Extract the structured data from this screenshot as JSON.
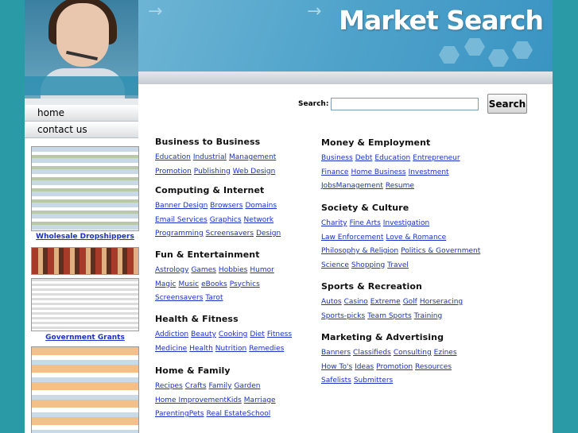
{
  "site": {
    "title": "Market Search",
    "colors": {
      "background": "#2a9aa6",
      "link": "#1a30c8",
      "banner": "#4fa3cb"
    }
  },
  "nav": {
    "items": [
      {
        "label": "home"
      },
      {
        "label": "contact us"
      }
    ]
  },
  "ads": [
    {
      "label": "Wholesale Dropshippers"
    },
    {
      "label": "Government Grants"
    }
  ],
  "search": {
    "label": "Search:",
    "value": "",
    "button_label": "Search"
  },
  "categories": {
    "left": [
      {
        "title": "Business to Business",
        "rows": [
          [
            "Education",
            "Industrial",
            "Management"
          ],
          [
            "Promotion",
            "Publishing",
            "Web Design"
          ]
        ]
      },
      {
        "title": "Computing & Internet",
        "rows": [
          [
            "Banner Design",
            "Browsers",
            "Domains"
          ],
          [
            "Email Services",
            "Graphics",
            "Network"
          ],
          [
            "Programming",
            "Screensavers",
            "Design"
          ]
        ]
      },
      {
        "title": "Fun & Entertainment",
        "rows": [
          [
            "Astrology",
            "Games",
            "Hobbies",
            "Humor"
          ],
          [
            "Magic",
            "Music",
            "eBooks",
            "Psychics"
          ],
          [
            "Screensavers",
            "Tarot"
          ]
        ]
      },
      {
        "title": "Health & Fitness",
        "rows": [
          [
            "Addiction",
            "Beauty",
            "Cooking",
            "Diet",
            "Fitness"
          ],
          [
            "Medicine",
            "Health",
            "Nutrition",
            "Remedies"
          ]
        ]
      },
      {
        "title": "Home & Family",
        "rows": [
          [
            "Recipes",
            "Crafts",
            "Family",
            "Garden"
          ],
          [
            "Home ImprovementKids",
            "Marriage"
          ],
          [
            "ParentingPets",
            "Real EstateSchool"
          ]
        ]
      }
    ],
    "right": [
      {
        "title": "Money & Employment",
        "rows": [
          [
            "Business",
            "Debt",
            "Education",
            "Entrepreneur"
          ],
          [
            "Finance",
            "Home Business",
            "Investment"
          ],
          [
            "JobsManagement",
            "Resume"
          ]
        ]
      },
      {
        "title": "Society & Culture",
        "rows": [
          [
            "Charity",
            "Fine Arts",
            "Investigation"
          ],
          [
            "Law Enforcement",
            "Love & Romance"
          ],
          [
            "Philosophy & Religion",
            "Politics & Government"
          ],
          [
            "Science",
            "Shopping",
            "Travel"
          ]
        ]
      },
      {
        "title": "Sports & Recreation",
        "rows": [
          [
            "Autos",
            "Casino",
            "Extreme",
            "Golf",
            "Horseracing"
          ],
          [
            "Sports-picks",
            "Team Sports",
            "Training"
          ]
        ]
      },
      {
        "title": "Marketing & Advertising",
        "rows": [
          [
            "Banners",
            "Classifieds",
            "Consulting",
            "Ezines"
          ],
          [
            "How To's",
            "Ideas",
            "Promotion",
            "Resources"
          ],
          [
            "Safelists",
            "Submitters"
          ]
        ]
      }
    ]
  }
}
